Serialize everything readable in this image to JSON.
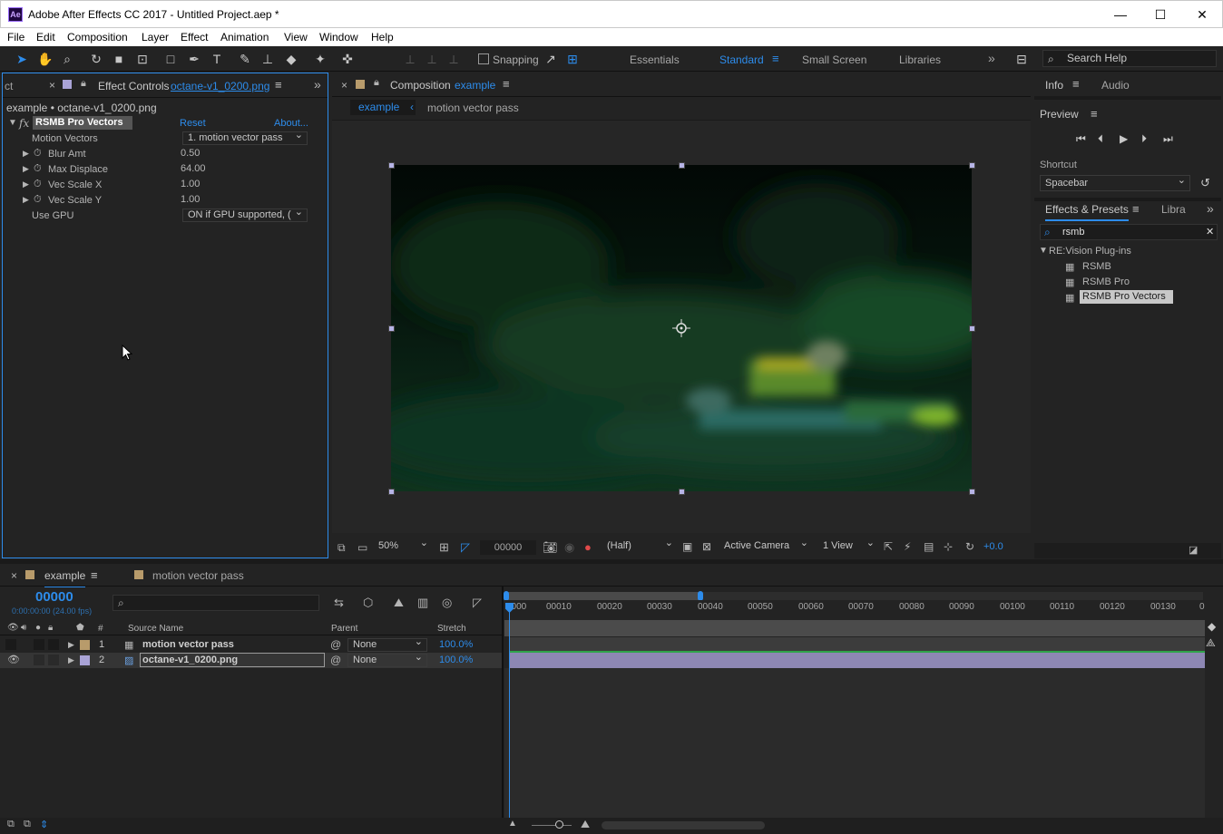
{
  "window": {
    "title": "Adobe After Effects CC 2017 - Untitled Project.aep *",
    "logo": "Ae"
  },
  "menu": [
    "File",
    "Edit",
    "Composition",
    "Layer",
    "Effect",
    "Animation",
    "View",
    "Window",
    "Help"
  ],
  "toolbar": {
    "snapping_label": "Snapping",
    "workspaces": [
      "Essentials",
      "Standard",
      "Small Screen",
      "Libraries"
    ],
    "active_workspace": "Standard",
    "search_placeholder": "Search Help"
  },
  "effect_controls": {
    "prev_tab_fragment": "ct",
    "tab_label": "Effect Controls",
    "tab_file": "octane-v1_0200.png",
    "breadcrumb": "example • octane-v1_0200.png",
    "effect_name": "RSMB Pro Vectors",
    "reset": "Reset",
    "about": "About...",
    "props": [
      {
        "label": "Motion Vectors",
        "value": "1. motion vector pass",
        "kind": "dropdown"
      },
      {
        "label": "Blur Amt",
        "value": "0.50",
        "kind": "number"
      },
      {
        "label": "Max Displace",
        "value": "64.00",
        "kind": "number"
      },
      {
        "label": "Vec Scale X",
        "value": "1.00",
        "kind": "number"
      },
      {
        "label": "Vec Scale Y",
        "value": "1.00",
        "kind": "number"
      },
      {
        "label": "Use GPU",
        "value": "ON if GPU supported, (",
        "kind": "dropdown"
      }
    ]
  },
  "composition": {
    "tab_label": "Composition",
    "tab_name": "example",
    "breadcrumbs": [
      "example",
      "motion vector pass"
    ],
    "zoom": "50%",
    "timecode": "00000",
    "resolution": "(Half)",
    "camera": "Active Camera",
    "views": "1 View",
    "exposure": "+0.0"
  },
  "right_panels": {
    "info_tab": "Info",
    "audio_tab": "Audio",
    "preview_title": "Preview",
    "shortcut_label": "Shortcut",
    "shortcut_value": "Spacebar",
    "effects_tab": "Effects & Presets",
    "libraries_tab_fragment": "Libra",
    "search_value": "rsmb",
    "tree_folder": "RE:Vision Plug-ins",
    "tree_items": [
      "RSMB",
      "RSMB Pro",
      "RSMB Pro Vectors"
    ],
    "selected_item": "RSMB Pro Vectors"
  },
  "timeline": {
    "tabs": [
      "example",
      "motion vector pass"
    ],
    "timecode": "00000",
    "timecode_sub": "0:00:00:00 (24.00 fps)",
    "columns": {
      "hash": "#",
      "source": "Source Name",
      "parent": "Parent",
      "stretch": "Stretch"
    },
    "layers": [
      {
        "num": "1",
        "name": "motion vector pass",
        "parent": "None",
        "stretch": "100.0%",
        "color": "#b89b6b"
      },
      {
        "num": "2",
        "name": "octane-v1_0200.png",
        "parent": "None",
        "stretch": "100.0%",
        "color": "#a9a3d6"
      }
    ],
    "ruler": [
      "0000",
      "00010",
      "00020",
      "00030",
      "00040",
      "00050",
      "00060",
      "00070",
      "00080",
      "00090",
      "00100",
      "00110",
      "00120",
      "00130",
      "0"
    ]
  }
}
